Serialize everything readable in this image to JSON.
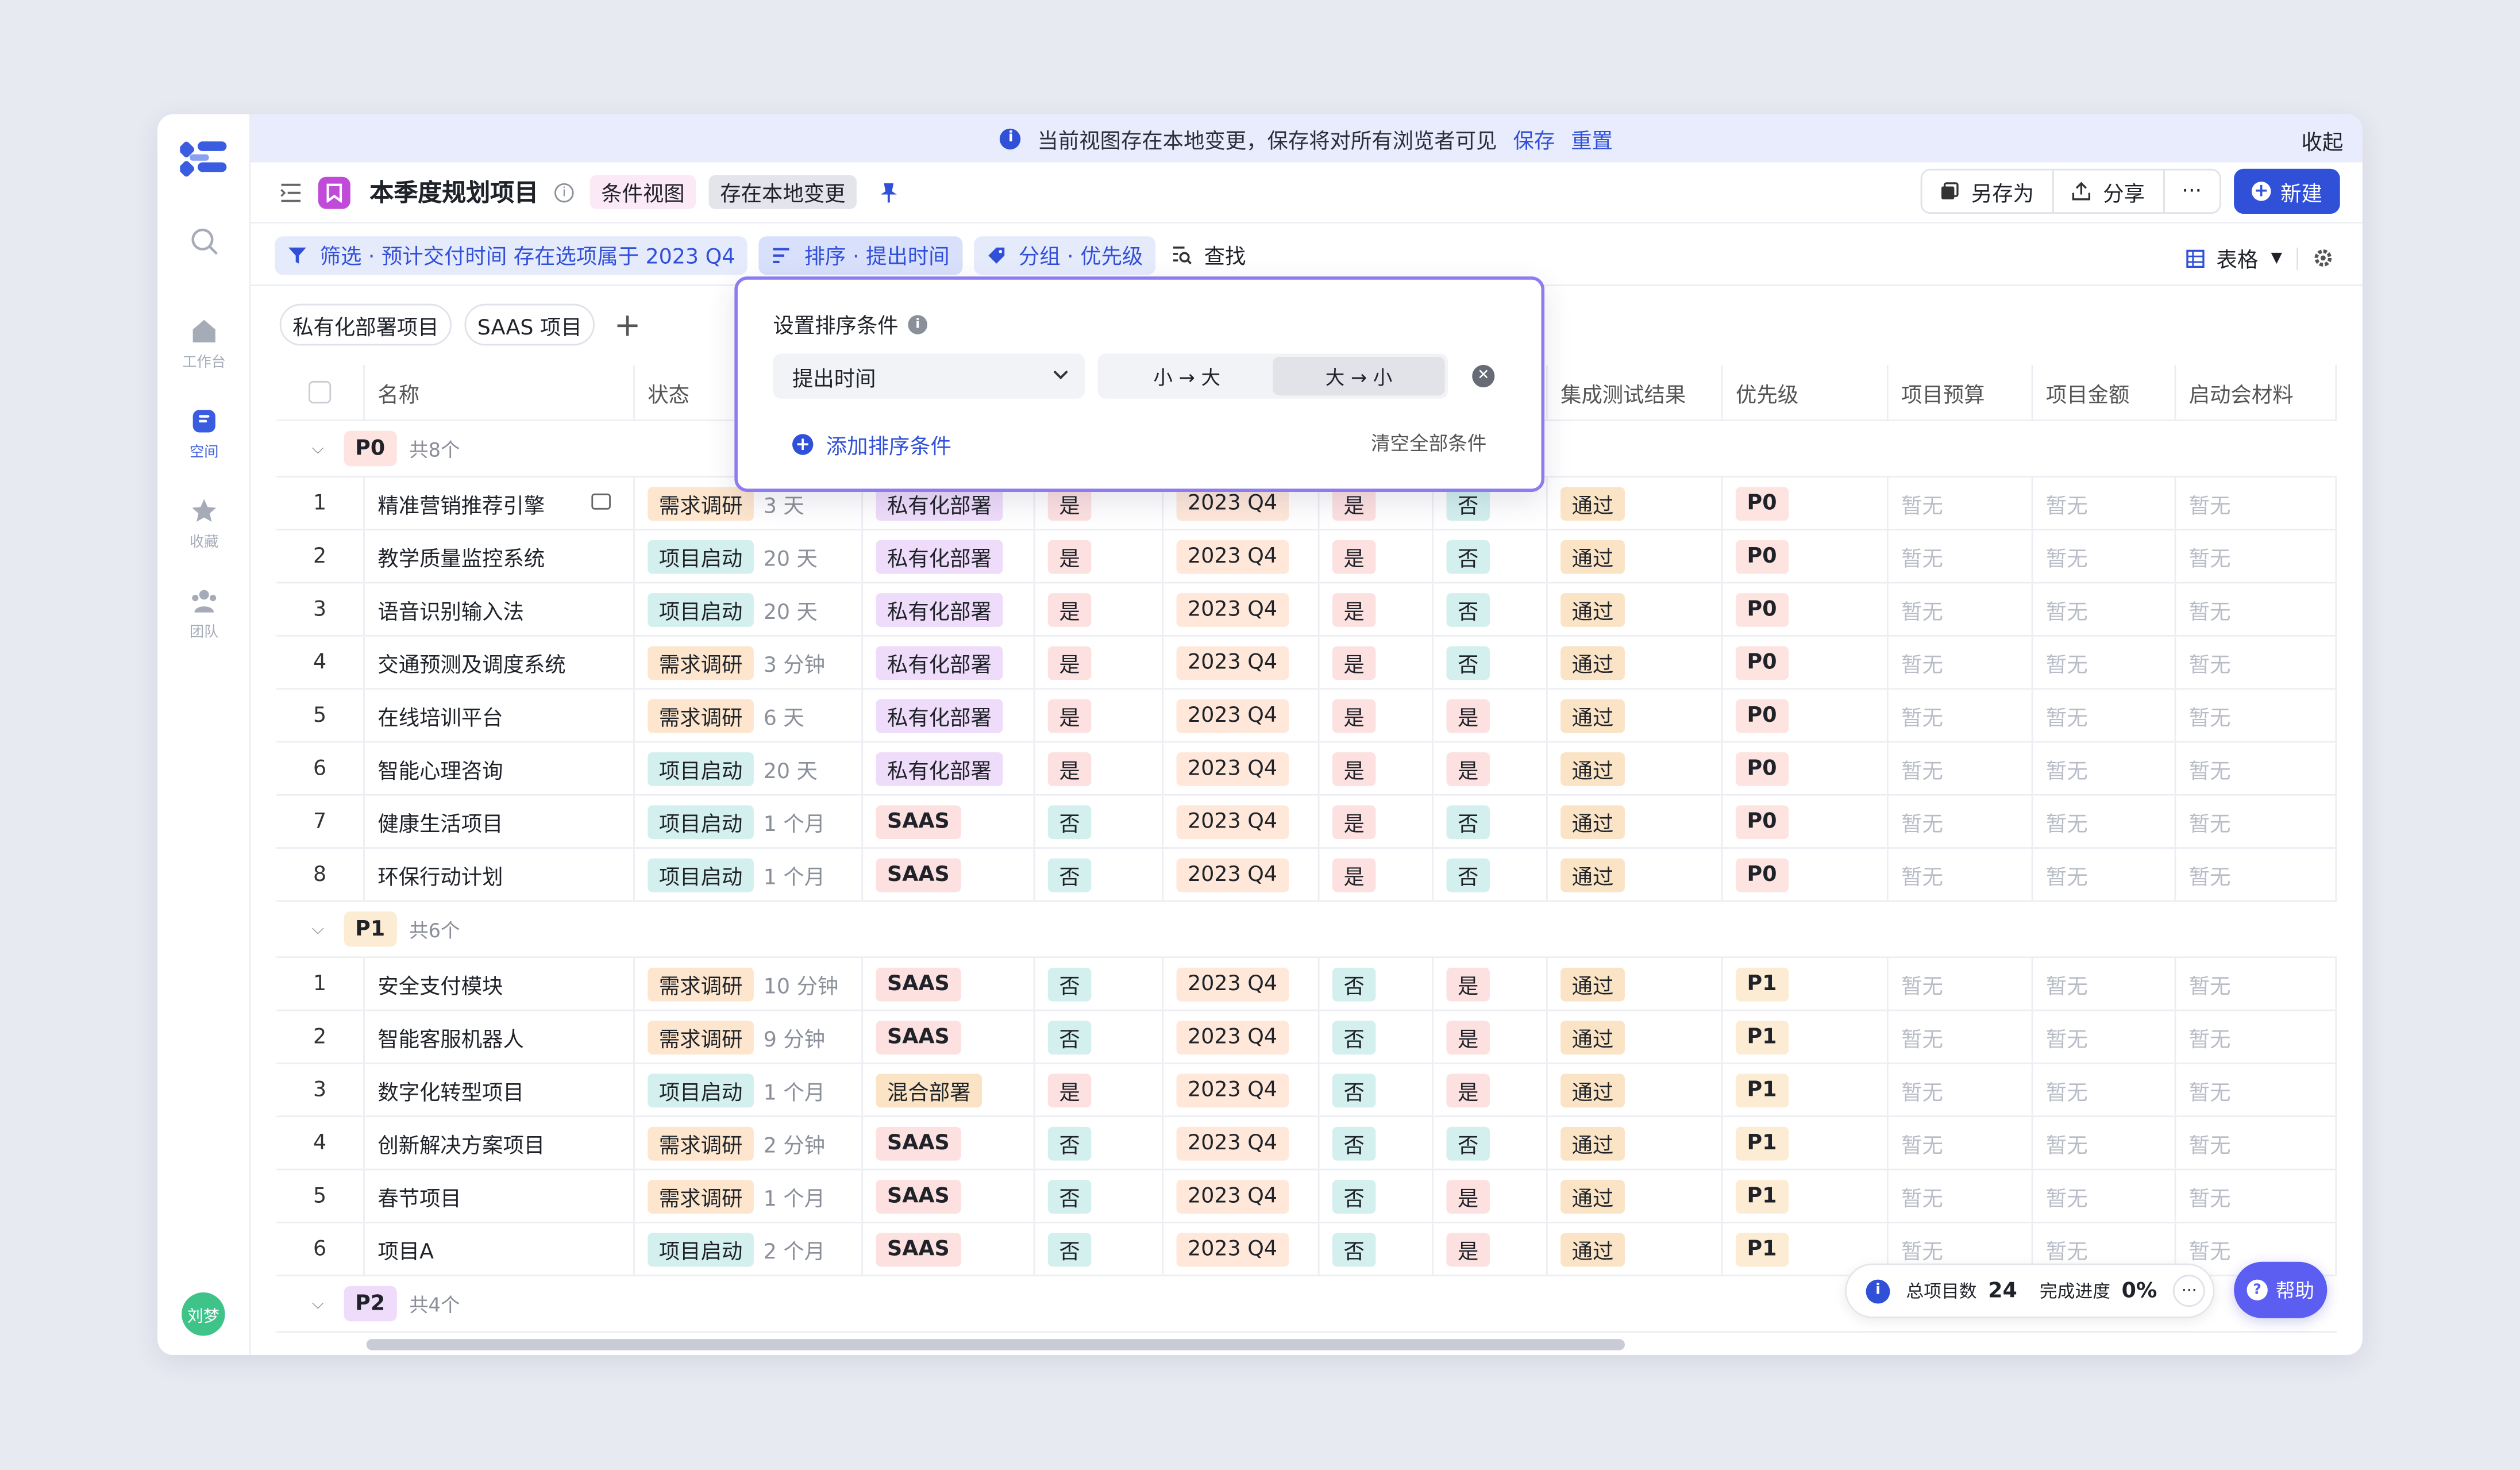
{
  "notice": {
    "text": "当前视图存在本地变更，保存将对所有浏览者可见",
    "save": "保存",
    "reset": "重置",
    "collapse": "收起"
  },
  "sidebar": {
    "items": [
      {
        "label": "",
        "icon": "search-icon"
      },
      {
        "label": "工作台",
        "icon": "home-icon"
      },
      {
        "label": "空间",
        "icon": "space-icon"
      },
      {
        "label": "收藏",
        "icon": "star-icon"
      },
      {
        "label": "团队",
        "icon": "team-icon"
      }
    ],
    "avatar": "刘梦"
  },
  "header": {
    "title": "本季度规划项目",
    "tag_view": "条件视图",
    "tag_local": "存在本地变更",
    "save_as": "另存为",
    "share": "分享",
    "more": "···",
    "new": "新建"
  },
  "toolbar": {
    "filter": "筛选 · 预计交付时间 存在选项属于 2023 Q4",
    "sort": "排序 · 提出时间",
    "group": "分组 · 优先级",
    "find": "查找",
    "view_type": "表格"
  },
  "tabs": [
    "私有化部署项目",
    "SAAS 项目"
  ],
  "columns": {
    "name": "名称",
    "status": "状态",
    "test_result": "集成测试结果",
    "priority": "优先级",
    "budget": "项目预算",
    "amount": "项目金额",
    "kickoff": "启动会材料"
  },
  "groups": [
    {
      "label": "P0",
      "count": "共8个",
      "rows": [
        {
          "idx": "1",
          "name": "精准营销推荐引擎",
          "status": "需求调研",
          "dur": "3 天",
          "deploy": "私有化部署",
          "c1": "是",
          "quarter": "2023 Q4",
          "c2": "是",
          "c3": "否",
          "result": "通过",
          "pri": "P0"
        },
        {
          "idx": "2",
          "name": "教学质量监控系统",
          "status": "项目启动",
          "dur": "20 天",
          "deploy": "私有化部署",
          "c1": "是",
          "quarter": "2023 Q4",
          "c2": "是",
          "c3": "否",
          "result": "通过",
          "pri": "P0"
        },
        {
          "idx": "3",
          "name": "语音识别输入法",
          "status": "项目启动",
          "dur": "20 天",
          "deploy": "私有化部署",
          "c1": "是",
          "quarter": "2023 Q4",
          "c2": "是",
          "c3": "否",
          "result": "通过",
          "pri": "P0"
        },
        {
          "idx": "4",
          "name": "交通预测及调度系统",
          "status": "需求调研",
          "dur": "3 分钟",
          "deploy": "私有化部署",
          "c1": "是",
          "quarter": "2023 Q4",
          "c2": "是",
          "c3": "否",
          "result": "通过",
          "pri": "P0"
        },
        {
          "idx": "5",
          "name": "在线培训平台",
          "status": "需求调研",
          "dur": "6 天",
          "deploy": "私有化部署",
          "c1": "是",
          "quarter": "2023 Q4",
          "c2": "是",
          "c3": "是",
          "result": "通过",
          "pri": "P0"
        },
        {
          "idx": "6",
          "name": "智能心理咨询",
          "status": "项目启动",
          "dur": "20 天",
          "deploy": "私有化部署",
          "c1": "是",
          "quarter": "2023 Q4",
          "c2": "是",
          "c3": "是",
          "result": "通过",
          "pri": "P0"
        },
        {
          "idx": "7",
          "name": "健康生活项目",
          "status": "项目启动",
          "dur": "1 个月",
          "deploy": "SAAS",
          "c1": "否",
          "quarter": "2023 Q4",
          "c2": "是",
          "c3": "否",
          "result": "通过",
          "pri": "P0"
        },
        {
          "idx": "8",
          "name": "环保行动计划",
          "status": "项目启动",
          "dur": "1 个月",
          "deploy": "SAAS",
          "c1": "否",
          "quarter": "2023 Q4",
          "c2": "是",
          "c3": "否",
          "result": "通过",
          "pri": "P0"
        }
      ]
    },
    {
      "label": "P1",
      "count": "共6个",
      "rows": [
        {
          "idx": "1",
          "name": "安全支付模块",
          "status": "需求调研",
          "dur": "10 分钟",
          "deploy": "SAAS",
          "c1": "否",
          "quarter": "2023 Q4",
          "c2": "否",
          "c3": "是",
          "result": "通过",
          "pri": "P1"
        },
        {
          "idx": "2",
          "name": "智能客服机器人",
          "status": "需求调研",
          "dur": "9 分钟",
          "deploy": "SAAS",
          "c1": "否",
          "quarter": "2023 Q4",
          "c2": "否",
          "c3": "是",
          "result": "通过",
          "pri": "P1"
        },
        {
          "idx": "3",
          "name": "数字化转型项目",
          "status": "项目启动",
          "dur": "1 个月",
          "deploy": "混合部署",
          "c1": "是",
          "quarter": "2023 Q4",
          "c2": "否",
          "c3": "是",
          "result": "通过",
          "pri": "P1"
        },
        {
          "idx": "4",
          "name": "创新解决方案项目",
          "status": "需求调研",
          "dur": "2 分钟",
          "deploy": "SAAS",
          "c1": "否",
          "quarter": "2023 Q4",
          "c2": "否",
          "c3": "否",
          "result": "通过",
          "pri": "P1"
        },
        {
          "idx": "5",
          "name": "春节项目",
          "status": "需求调研",
          "dur": "1 个月",
          "deploy": "SAAS",
          "c1": "否",
          "quarter": "2023 Q4",
          "c2": "否",
          "c3": "是",
          "result": "通过",
          "pri": "P1"
        },
        {
          "idx": "6",
          "name": "项目A",
          "status": "项目启动",
          "dur": "2 个月",
          "deploy": "SAAS",
          "c1": "否",
          "quarter": "2023 Q4",
          "c2": "否",
          "c3": "是",
          "result": "通过",
          "pri": "P1"
        }
      ]
    },
    {
      "label": "P2",
      "count": "共4个",
      "rows": []
    }
  ],
  "empty_text": "暂无",
  "sort_popover": {
    "title": "设置排序条件",
    "field": "提出时间",
    "asc": "小 → 大",
    "desc": "大 → 小",
    "add": "添加排序条件",
    "clear": "清空全部条件"
  },
  "stats": {
    "total_label": "总项目数",
    "total": "24",
    "progress_label": "完成进度",
    "progress": "0%"
  },
  "help": "帮助",
  "colors": {
    "accent": "#3150d8",
    "help": "#5b5ef0",
    "view_badge": "#c04bd9"
  }
}
